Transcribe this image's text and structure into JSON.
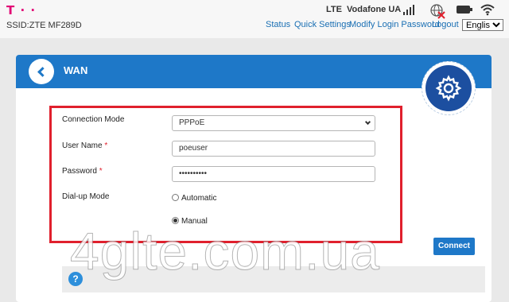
{
  "header": {
    "logo": "T · ·",
    "ssid": "SSID:ZTE MF289D",
    "network_type": "LTE",
    "operator": "Vodafone UA",
    "icons": [
      "signal-bars-icon",
      "internet-globe-icon",
      "battery-icon",
      "wifi-icon"
    ],
    "nav": [
      "Status",
      "Quick Settings",
      "Modify Login Password",
      "Logout"
    ],
    "language": {
      "selected": "English",
      "options": [
        "English"
      ]
    }
  },
  "panel": {
    "title": "WAN",
    "icons": {
      "back": "back-arrow-icon",
      "settings": "gear-icon"
    }
  },
  "form": {
    "connection_mode": {
      "label": "Connection Mode",
      "value": "PPPoE"
    },
    "user_name": {
      "label": "User Name",
      "required_mark": "*",
      "value": "poeuser"
    },
    "password": {
      "label": "Password",
      "required_mark": "*",
      "value": "••••••••••"
    },
    "dialup_mode": {
      "label": "Dial-up Mode",
      "options": [
        {
          "label": "Automatic",
          "selected": false
        },
        {
          "label": "Manual",
          "selected": true
        }
      ]
    },
    "connect_label": "Connect"
  },
  "help": {
    "icon": "?"
  },
  "watermark": "4glte.com.ua",
  "colors": {
    "brand": "#e20074",
    "accent": "#1e78c8",
    "highlight": "#e0202d",
    "gear_bg": "#1c4fa0"
  }
}
